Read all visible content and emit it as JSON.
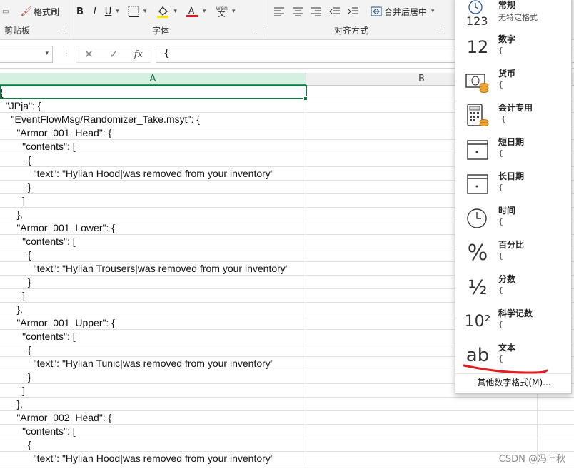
{
  "ribbon": {
    "format_painter_label": "格式刷",
    "clipboard_group": "剪贴板",
    "font_group": "字体",
    "alignment_group": "对齐方式",
    "bold": "B",
    "italic": "I",
    "underline": "U",
    "merge_center_label": "合并后居中",
    "phonetic_top": "wén",
    "phonetic_bottom": "文"
  },
  "formula_bar": {
    "cancel": "✕",
    "enter": "✓",
    "function": "fx",
    "content": "{"
  },
  "columns": [
    "A",
    "B"
  ],
  "rows": [
    "{",
    "  \"JPja\": {",
    "    \"EventFlowMsg/Randomizer_Take.msyt\": {",
    "      \"Armor_001_Head\": {",
    "        \"contents\": [",
    "          {",
    "            \"text\": \"Hylian Hood|was removed from your inventory\"",
    "          }",
    "        ]",
    "      },",
    "      \"Armor_001_Lower\": {",
    "        \"contents\": [",
    "          {",
    "            \"text\": \"Hylian Trousers|was removed from your inventory\"",
    "          }",
    "        ]",
    "      },",
    "      \"Armor_001_Upper\": {",
    "        \"contents\": [",
    "          {",
    "            \"text\": \"Hylian Tunic|was removed from your inventory\"",
    "          }",
    "        ]",
    "      },",
    "      \"Armor_002_Head\": {",
    "        \"contents\": [",
    "          {",
    "            \"text\": \"Hylian Hood|was removed from your inventory\""
  ],
  "number_format_menu": {
    "items": [
      {
        "name": "常规",
        "sample": "无特定格式",
        "icon": "clock-123-icon",
        "icon_text": "123"
      },
      {
        "name": "数字",
        "sample": "{",
        "icon": "number-icon",
        "icon_text": "12"
      },
      {
        "name": "货币",
        "sample": "{",
        "icon": "currency-icon",
        "icon_text": ""
      },
      {
        "name": "会计专用",
        "sample": "{",
        "icon": "accounting-icon",
        "icon_text": ""
      },
      {
        "name": "短日期",
        "sample": "{",
        "icon": "short-date-icon",
        "icon_text": ""
      },
      {
        "name": "长日期",
        "sample": "{",
        "icon": "long-date-icon",
        "icon_text": ""
      },
      {
        "name": "时间",
        "sample": "{",
        "icon": "time-icon",
        "icon_text": ""
      },
      {
        "name": "百分比",
        "sample": "{",
        "icon": "percent-icon",
        "icon_text": "%"
      },
      {
        "name": "分数",
        "sample": "{",
        "icon": "fraction-icon",
        "icon_text": "½"
      },
      {
        "name": "科学记数",
        "sample": "{",
        "icon": "scientific-icon",
        "icon_text": "10²"
      },
      {
        "name": "文本",
        "sample": "{",
        "icon": "text-icon",
        "icon_text": "ab"
      }
    ],
    "more_label": "其他数字格式(M)..."
  },
  "watermark": "CSDN @冯叶秋",
  "colors": {
    "accent_green": "#217346",
    "font_color_red": "#e81123",
    "highlight_yellow": "#ffe600",
    "annotation_red": "#e02020"
  }
}
